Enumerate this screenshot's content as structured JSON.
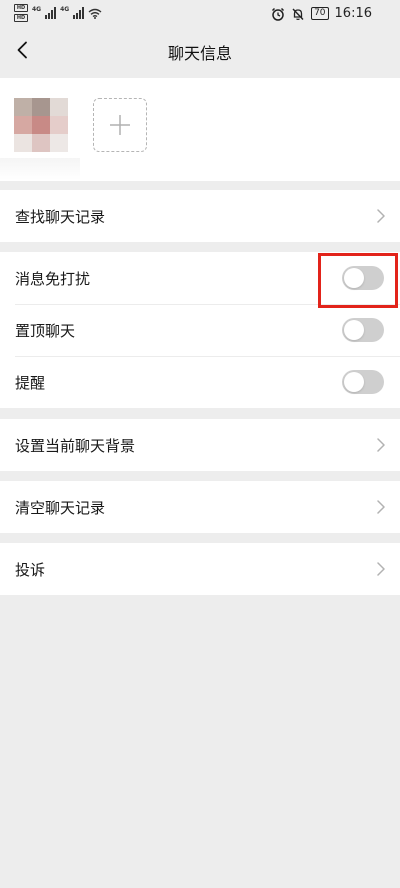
{
  "status_bar": {
    "sim_tags": [
      "HD",
      "HD"
    ],
    "network_left": "4G",
    "network_right": "4G",
    "battery": "70",
    "time": "16:16"
  },
  "header": {
    "title": "聊天信息"
  },
  "members": {
    "add_icon": "plus-icon"
  },
  "sections": {
    "search": {
      "label": "查找聊天记录"
    },
    "mute": {
      "label": "消息免打扰",
      "on": false
    },
    "pin": {
      "label": "置顶聊天",
      "on": false
    },
    "remind": {
      "label": "提醒",
      "on": false
    },
    "background": {
      "label": "设置当前聊天背景"
    },
    "clear": {
      "label": "清空聊天记录"
    },
    "report": {
      "label": "投诉"
    }
  },
  "colors": {
    "highlight": "#e2231a",
    "toggle_off": "#cfcfcf",
    "page_bg": "#ededed"
  }
}
